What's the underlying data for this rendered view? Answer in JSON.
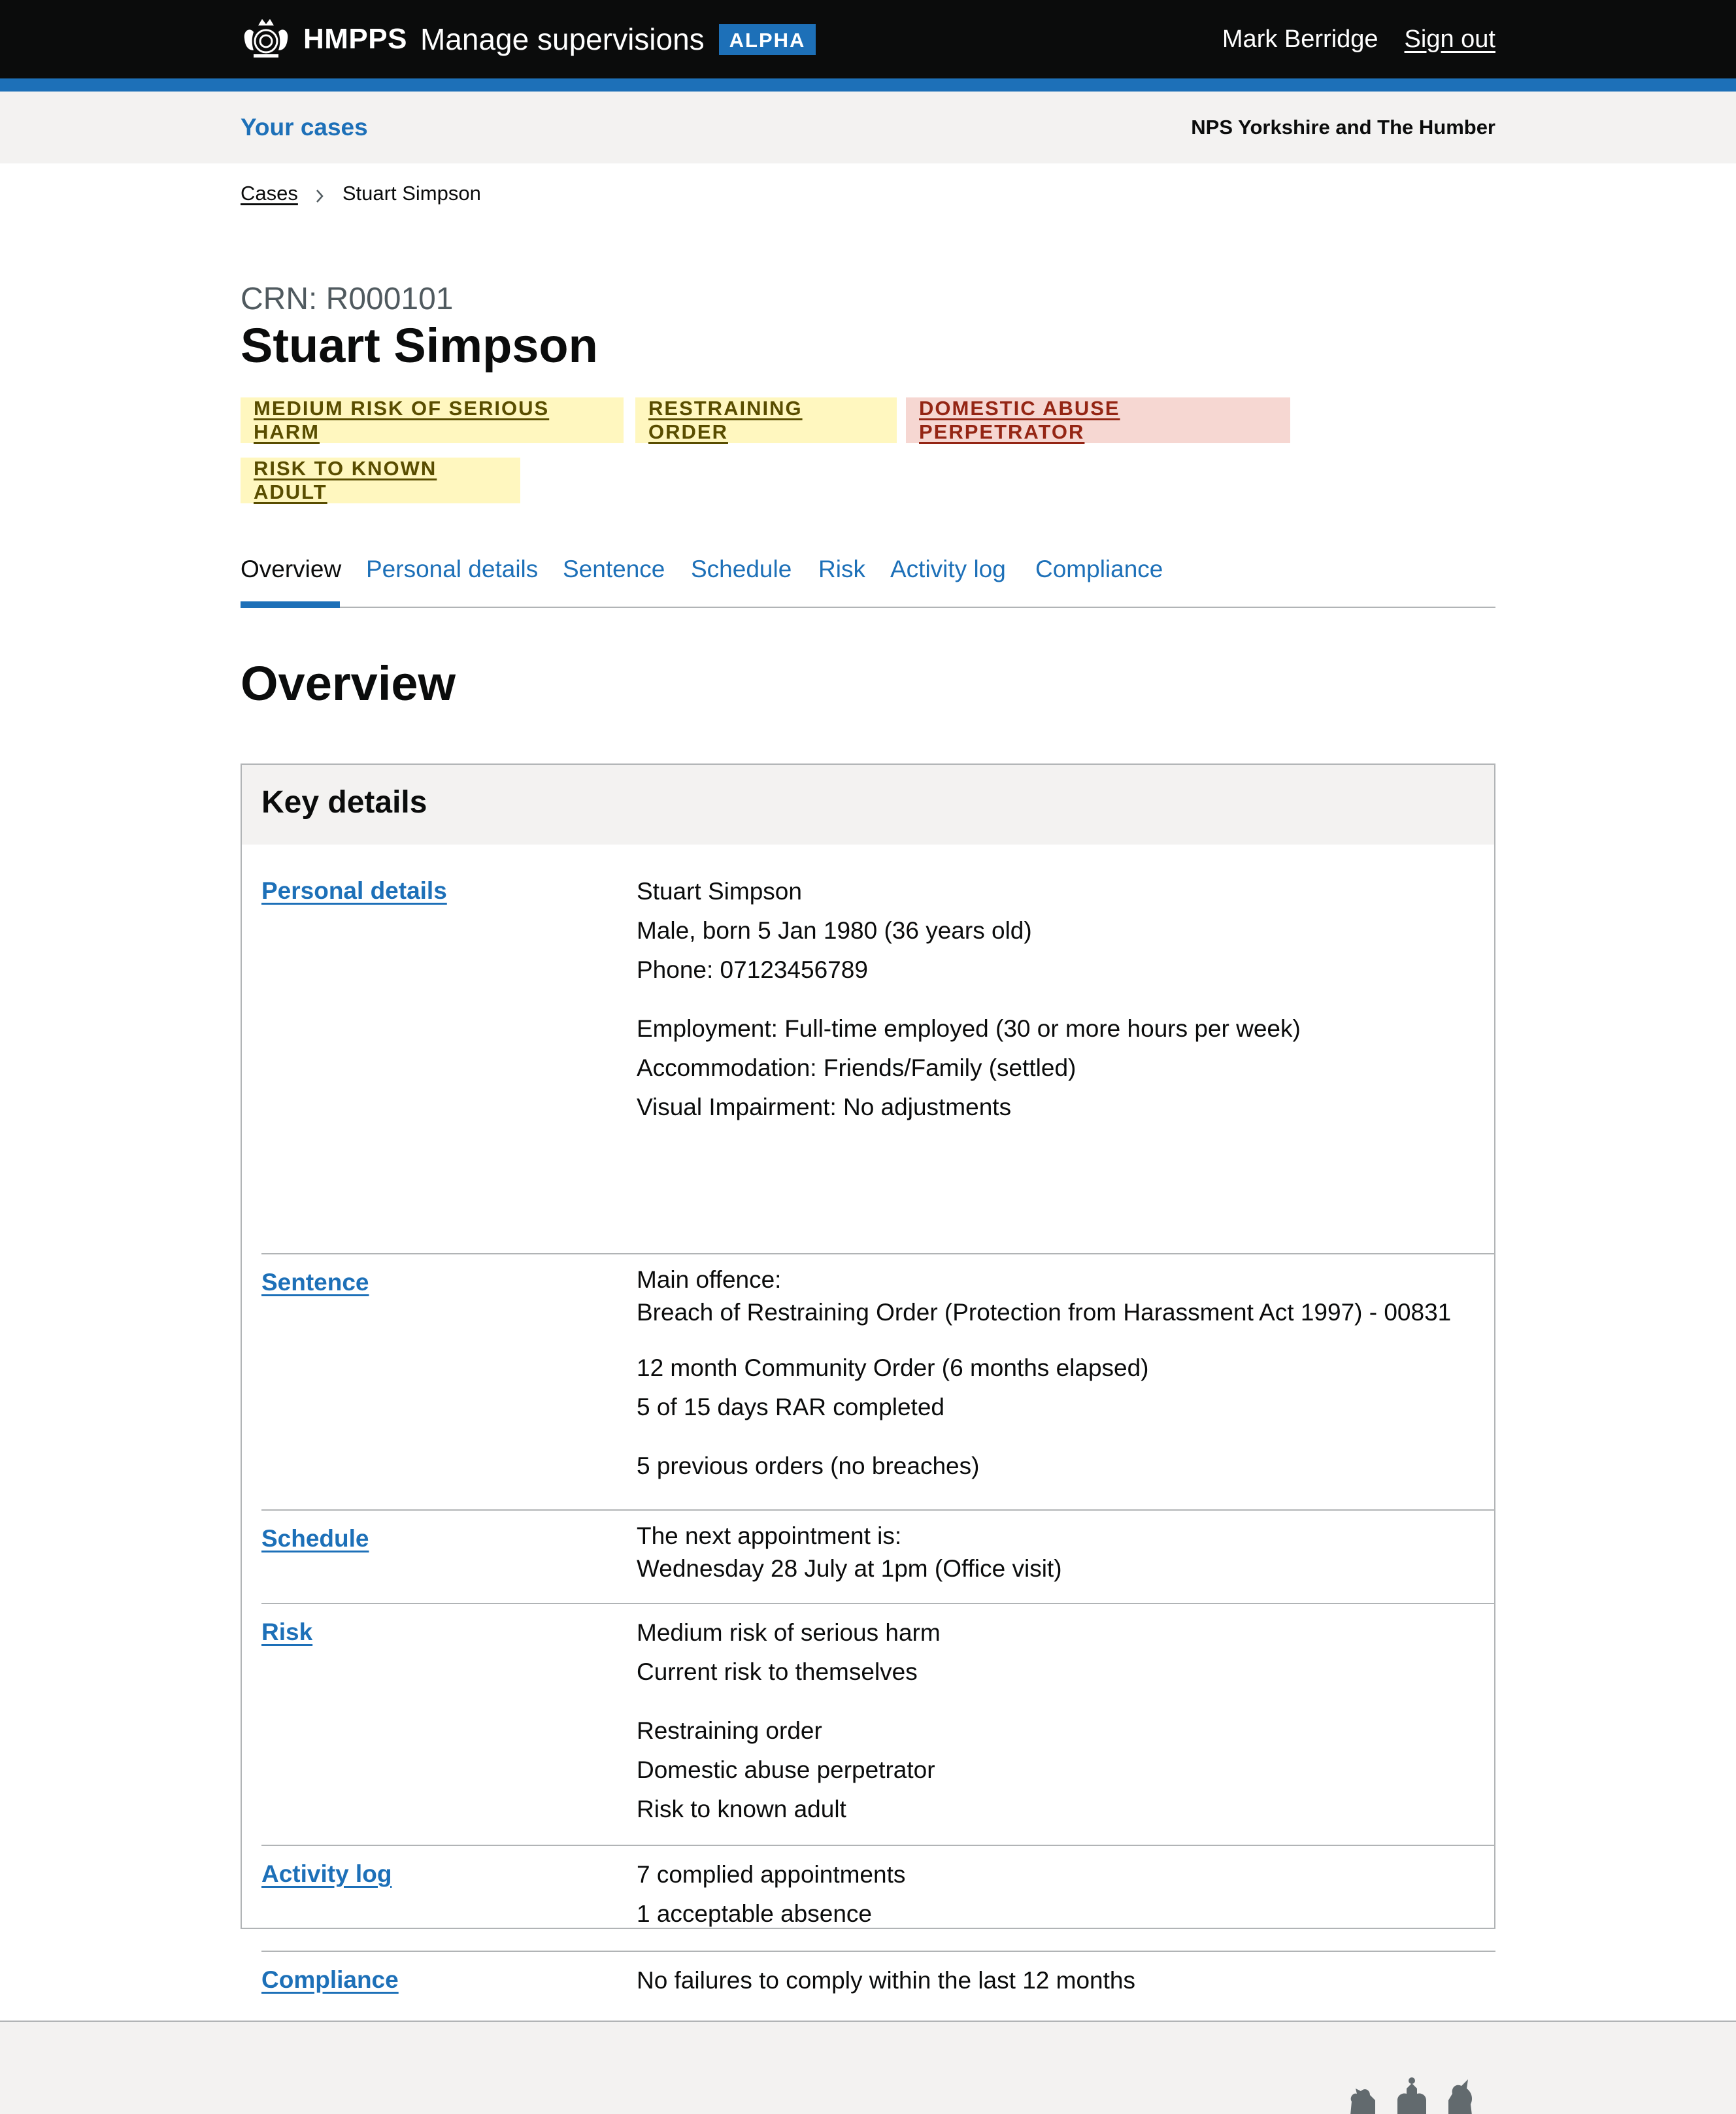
{
  "header": {
    "brand": "HMPPS",
    "service_name": "Manage supervisions",
    "phase_tag": "ALPHA",
    "user_name": "Mark Berridge",
    "sign_out_label": "Sign out"
  },
  "subnav": {
    "your_cases": "Your cases",
    "region": "NPS Yorkshire and The Humber"
  },
  "breadcrumb": {
    "items": [
      "Cases",
      "Stuart Simpson"
    ]
  },
  "case": {
    "crn": "CRN: R000101",
    "name": "Stuart Simpson"
  },
  "tags": [
    {
      "label": "MEDIUM RISK OF SERIOUS HARM",
      "color": "#fff7bf"
    },
    {
      "label": "RESTRAINING ORDER",
      "color": "#fff7bf"
    },
    {
      "label": "DOMESTIC ABUSE PERPETRATOR",
      "color": "#f6d7d2"
    },
    {
      "label": "RISK TO KNOWN ADULT",
      "color": "#fff7bf"
    }
  ],
  "tabs": [
    {
      "label": "Overview",
      "active": true
    },
    {
      "label": "Personal details",
      "active": false
    },
    {
      "label": "Sentence",
      "active": false
    },
    {
      "label": "Schedule",
      "active": false
    },
    {
      "label": "Risk",
      "active": false
    },
    {
      "label": "Activity log",
      "active": false
    },
    {
      "label": "Compliance",
      "active": false
    }
  ],
  "section_title": "Overview",
  "key_details": {
    "title": "Key details",
    "rows": [
      {
        "key": "Personal details",
        "groups": [
          [
            "Stuart Simpson",
            "Male, born 5 Jan 1980 (36 years old)",
            "Phone: 07123456789"
          ],
          [
            "Employment: Full-time employed (30 or more hours per week)",
            "Accommodation: Friends/Family (settled)",
            "Visual Impairment: No adjustments"
          ]
        ]
      },
      {
        "key": "Sentence",
        "groups": [
          [
            "Main offence:",
            "Breach of Restraining Order (Protection from Harassment Act 1997) - 00831"
          ],
          [
            "12 month Community Order (6 months elapsed)",
            "5 of 15 days RAR completed"
          ],
          [
            "5 previous orders (no breaches)"
          ]
        ]
      },
      {
        "key": "Schedule",
        "groups": [
          [
            "The next appointment is:",
            "Wednesday 28 July at 1pm (Office visit)"
          ]
        ]
      },
      {
        "key": "Risk",
        "groups": [
          [
            "Medium risk of serious harm",
            "Current risk to themselves"
          ],
          [
            "Restraining order",
            "Domestic abuse perpetrator",
            "Risk to known adult"
          ]
        ]
      },
      {
        "key": "Activity log",
        "groups": [
          [
            "7 complied appointments",
            "1 acceptable absence"
          ]
        ]
      },
      {
        "key": "Compliance",
        "groups": [
          [
            "No failures to comply within the last 12 months"
          ]
        ]
      }
    ]
  },
  "colors": {
    "brand_blue": "#1d70b8",
    "header_black": "#0b0c0c",
    "light_grey": "#f3f2f1",
    "border_grey": "#b1b4b6",
    "secondary_text": "#505a5f"
  }
}
